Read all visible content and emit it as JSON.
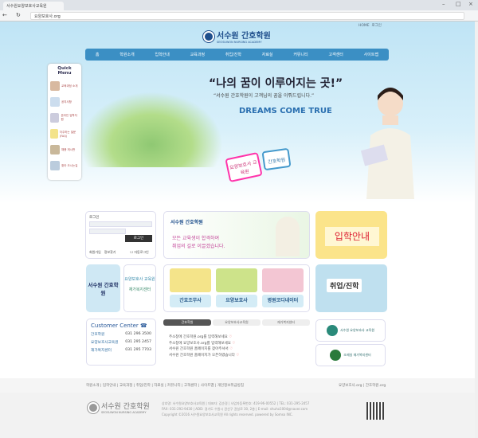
{
  "browser": {
    "tab_title": "서수원요양보호사교육원",
    "url": "요양보호사.org"
  },
  "header": {
    "top_links": [
      "HOME",
      "로그인"
    ],
    "logo_title": "서수원 간호학원",
    "logo_sub": "SEOSUWON NURSING ACADEMY",
    "nav": [
      "홈",
      "학원소개",
      "입학안내",
      "교육과정",
      "취업/진학",
      "자료실",
      "커뮤니티",
      "고객센터",
      "사이트맵"
    ]
  },
  "quick_menu": {
    "title": "Quick Menu",
    "items": [
      "교육과정 소개",
      "공지사항",
      "온라인 입학지원",
      "자주하는 질문(FAQ)",
      "채용 게시판",
      "찾아 오시는길"
    ]
  },
  "hero": {
    "headline": "“나의 꿈이 이루어지는 곳!”",
    "subline": "“서수원 간호학원이 고객님의 꿈을 이뤄드립니다.”",
    "slogan": "DREAMS COME TRUE",
    "tag1": "요양보호사 교육원",
    "tag2": "간호학원"
  },
  "login": {
    "title": "로그인",
    "button": "로그인",
    "join": "회원가입",
    "find": "정보찾기",
    "auto": "자동로그인"
  },
  "banner": {
    "logo": "서수원 간호학원",
    "text1": "모든 교육생이 합격하여",
    "text2": "취업의 길로 이끌겠습니다."
  },
  "admission": "입학안내",
  "side_links": {
    "academy": "서수원 간호학원",
    "care1": "요양보호사 교육원",
    "care2": "재가복지센터"
  },
  "courses": [
    {
      "label": "간호조무사",
      "color": "#f4e48a"
    },
    {
      "label": "요양보호사",
      "color": "#cde38a"
    },
    {
      "label": "병원코디네이터",
      "color": "#f3c6d3"
    }
  ],
  "job": "취업/진학",
  "customer_center": {
    "title": "Customer Center",
    "rows": [
      {
        "name": "간호학원",
        "phone": "031 296 3500"
      },
      {
        "name": "요양보호사교육원",
        "phone": "031 295 2457"
      },
      {
        "name": "재가복지센터",
        "phone": "031 295 7703"
      }
    ]
  },
  "notice": {
    "tabs": [
      "간호학원",
      "요양보호사교육원",
      "재가복지센터"
    ],
    "items": [
      "주소창에 간호학원.org를 입력해보세요",
      "주소창에 요양보호사.org를 입력해보세요",
      "서수원 간호학원 홈페이지를 찾아주셔서",
      "서수원 간호학원 홈페이지가 오픈하였습니다"
    ]
  },
  "partners": [
    "서수원 요양보호사 교육원",
    "조제실 재가복지센터"
  ],
  "footer": {
    "links": "학원소개 | 입학안내 | 교육과정 | 취업/진학 | 자료실 | 커뮤니티 | 고객센터 | 사이트맵 | 개인정보취급방침",
    "right": "요양보호사.org | 간호학원.org",
    "logo": "서수원 간호학원",
    "logo_sub": "SEOSUWON NURSING ACADEMY",
    "info": [
      "상호명: 서수원요양보호사교육원 | 대표자: 김순경 | 사업자등록번호: 419-96-00552 | TEL: 031-295-2457",
      "FAX: 031-292-9430 | ADD: 경기도 수원시 권선구 권실로 30, 2층 | E-mail: shuho1004@naver.com",
      "Copyright ©2016 서수원요양보호사교육원 All rights reserved. powered by Somso INC."
    ]
  }
}
